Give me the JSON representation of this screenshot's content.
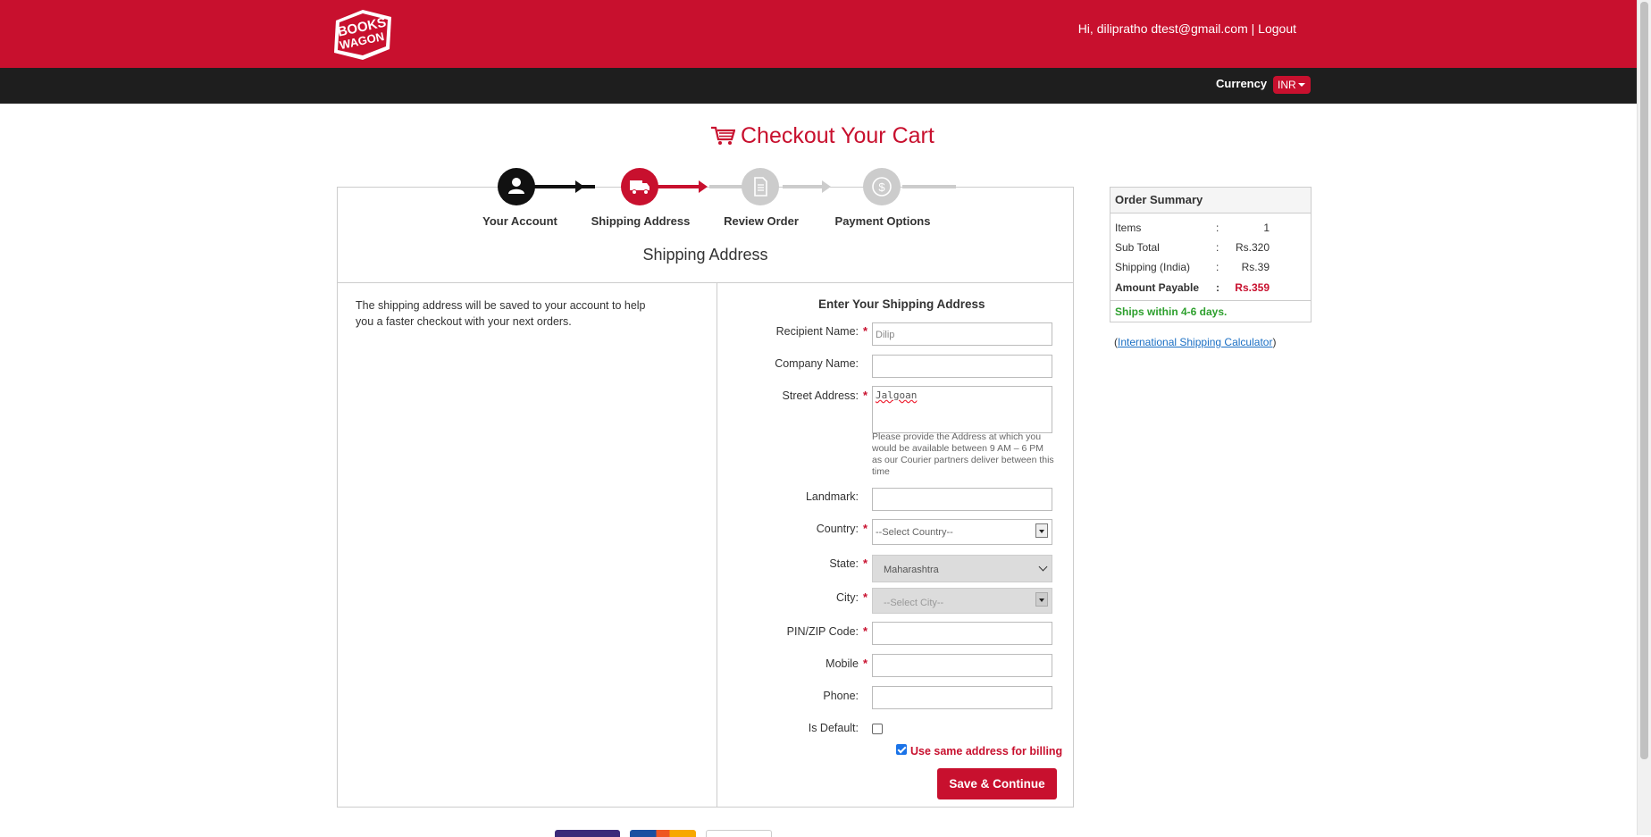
{
  "header": {
    "logo_text": "BOOKS WAGON",
    "greeting": "Hi, dilipratho dtest@gmail.com",
    "separator": "|",
    "logout_label": "Logout"
  },
  "currency": {
    "label": "Currency",
    "value": "INR"
  },
  "page": {
    "title": "Checkout Your Cart",
    "section_title": "Shipping Address"
  },
  "steps": [
    {
      "label": "Your Account",
      "state": "done"
    },
    {
      "label": "Shipping Address",
      "state": "active"
    },
    {
      "label": "Review Order",
      "state": "pending"
    },
    {
      "label": "Payment Options",
      "state": "pending"
    }
  ],
  "info_note": "The shipping address will be saved to your account to help you a faster checkout with your next orders.",
  "form": {
    "heading": "Enter Your Shipping Address",
    "recipient": {
      "label": "Recipient Name:",
      "value": "Dilip"
    },
    "company": {
      "label": "Company Name:",
      "value": ""
    },
    "street": {
      "label": "Street Address:",
      "value": "Jalgoan",
      "helper": "Please provide the Address at which you would be available between 9 AM – 6 PM as our Courier partners deliver between this time"
    },
    "landmark": {
      "label": "Landmark:",
      "value": ""
    },
    "country": {
      "label": "Country:",
      "value": "--Select Country--"
    },
    "state": {
      "label": "State:",
      "value": "Maharashtra"
    },
    "city": {
      "label": "City:",
      "value": "--Select City--"
    },
    "pin": {
      "label": "PIN/ZIP Code:",
      "value": ""
    },
    "mobile": {
      "label": "Mobile",
      "value": ""
    },
    "phone": {
      "label": "Phone:",
      "value": ""
    },
    "is_default": {
      "label": "Is Default:",
      "checked": false
    },
    "same_billing": {
      "label": "Use same address for billing",
      "checked": true
    },
    "required_mark": "*",
    "submit_label": "Save & Continue"
  },
  "order_summary": {
    "title": "Order Summary",
    "rows": [
      {
        "label": "Items",
        "colon": ":",
        "value": "1"
      },
      {
        "label": "Sub Total",
        "colon": ":",
        "value": "Rs.320"
      },
      {
        "label": "Shipping (India)",
        "colon": ":",
        "value": "Rs.39"
      },
      {
        "label": "Amount Payable",
        "colon": ":",
        "value": "Rs.359"
      }
    ],
    "ships_note": "Ships within 4-6 days.",
    "calculator_open": "(",
    "calculator_link": "International Shipping Calculator",
    "calculator_close": ")"
  },
  "colors": {
    "brand_red": "#c8102e",
    "dark_bar": "#1e1e1e",
    "ships_green": "#2ea02e",
    "link_blue": "#1a6fc4"
  }
}
